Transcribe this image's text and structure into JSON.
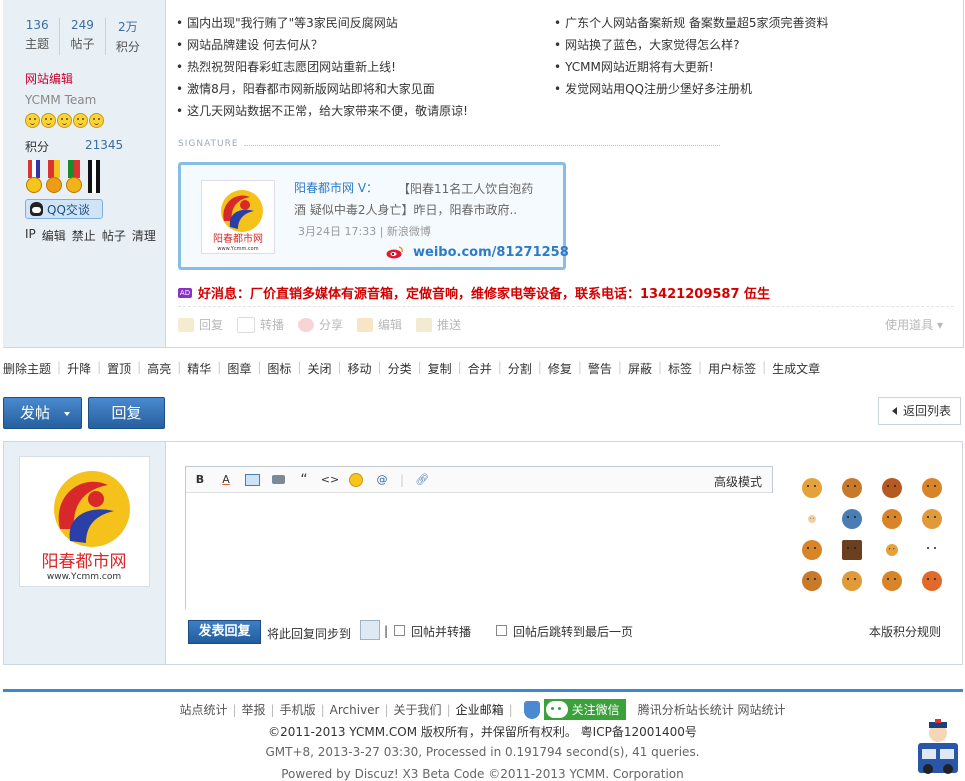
{
  "user": {
    "stats": [
      {
        "num": "136",
        "label": "主题"
      },
      {
        "num": "249",
        "label": "帖子"
      },
      {
        "num": "2万",
        "label": "积分"
      }
    ],
    "group": "网站编辑",
    "team": "YCMM Team",
    "credits_label": "积分",
    "credits_value": "21345",
    "qq_label": "QQ交谈",
    "admin_links": [
      "IP",
      "编辑",
      "禁止",
      "帖子",
      "清理"
    ]
  },
  "news_left": [
    "国内出现\"我行贿了\"等3家民间反腐网站",
    "网站品牌建设 何去何从？",
    "热烈祝贺阳春彩虹志愿团网站重新上线!",
    "激情8月，阳春都市网新版网站即将和大家见面",
    "这几天网站数据不正常，给大家带来不便，敬请原谅!"
  ],
  "news_right": [
    "广东个人网站备案新规 备案数量超5家须完善资料",
    "网站换了蓝色，大家觉得怎么样?",
    "YCMM网站近期将有大更新!",
    "发觉网站用QQ注册少堡好多注册机"
  ],
  "signature": {
    "label": "SIGNATURE",
    "weibo_name": "阳春都市网 V：",
    "weibo_text": "【阳春11名工人饮自泡药酒 疑似中毒2人身亡】昨日，阳春市政府..",
    "weibo_date": "3月24日 17:33 | 新浪微博",
    "weibo_link": "weibo.com/81271258",
    "logo_text": "阳春都市网",
    "logo_url": "www.Ycmm.com"
  },
  "ad": {
    "badge": "AD",
    "text": "好消息：厂价直销多媒体有源音箱，定做音响，维修家电等设备，联系电话：13421209587 伍生"
  },
  "post_actions": [
    "回复",
    "转播",
    "分享",
    "编辑",
    "推送"
  ],
  "tools_label": "使用道具 ▾",
  "mod_actions": [
    "删除主题",
    "升降",
    "置顶",
    "高亮",
    "精华",
    "图章",
    "图标",
    "关闭",
    "移动",
    "分类",
    "复制",
    "合并",
    "分割",
    "修复",
    "警告",
    "屏蔽",
    "标签",
    "用户标签",
    "生成文章"
  ],
  "buttons": {
    "post": "发帖",
    "reply": "回复",
    "back": "返回列表"
  },
  "editor": {
    "adv_mode": "高级模式",
    "submit": "发表回复",
    "sync_label": "将此回复同步到",
    "opt1": "回帖并转播",
    "opt2": "回帖后跳转到最后一页",
    "rules": "本版积分规则"
  },
  "footer": {
    "links": [
      "站点统计",
      "举报",
      "手机版",
      "Archiver",
      "关于我们",
      "企业邮箱"
    ],
    "wechat": "关注微信",
    "stats_links": "腾讯分析站长统计 网站统计",
    "copyright": "©2011-2013 YCMM.COM 版权所有，并保留所有权利。 粤ICP备12001400号",
    "gmt": "GMT+8, 2013-3-27 03:30, Processed in 0.191794 second(s), 41 queries.",
    "powered": "Powered by Discuz! X3 Beta Code ©2011-2013 YCMM. Corporation"
  },
  "colors": {
    "accent": "#2d6bb0",
    "sidebar_bg": "#e8eff5",
    "group_red": "#c8002b",
    "ad_red": "#d40000",
    "footer_blue": "#3b8ad0"
  }
}
